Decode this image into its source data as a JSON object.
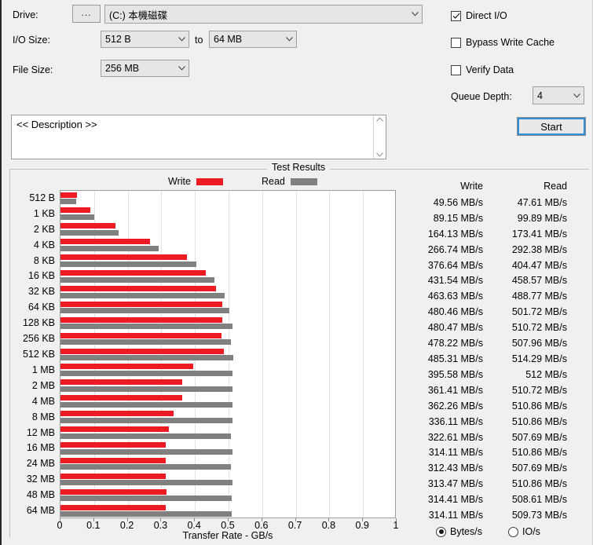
{
  "form": {
    "drive_label": "Drive:",
    "browse_button": "...",
    "drive_value": "(C:) 本機磁碟",
    "io_size_label": "I/O Size:",
    "io_size_from": "512 B",
    "io_size_to_label": "to",
    "io_size_to": "64 MB",
    "file_size_label": "File Size:",
    "file_size_value": "256 MB"
  },
  "options": {
    "direct_io": {
      "label": "Direct I/O",
      "checked": true
    },
    "bypass_write_cache": {
      "label": "Bypass Write Cache",
      "checked": false
    },
    "verify_data": {
      "label": "Verify Data",
      "checked": false
    },
    "queue_depth_label": "Queue Depth:",
    "queue_depth_value": "4",
    "start_button": "Start"
  },
  "description": {
    "text": "<< Description >>",
    "scroll_up_icon": "chevron-up-icon",
    "scroll_down_icon": "chevron-down-icon"
  },
  "results": {
    "group_title": "Test Results",
    "legend": [
      {
        "name": "Write",
        "color": "#ed1c24"
      },
      {
        "name": "Read",
        "color": "#808080"
      }
    ],
    "col_write": "Write",
    "col_read": "Read",
    "units": {
      "bytes_per_sec": {
        "label": "Bytes/s",
        "selected": true
      },
      "io_per_sec": {
        "label": "IO/s",
        "selected": false
      }
    }
  },
  "chart_data": {
    "type": "bar",
    "orientation": "horizontal",
    "title": "Test Results",
    "xlabel": "Transfer Rate - GB/s",
    "ylabel": "",
    "xlim": [
      0,
      1
    ],
    "xticks": [
      "0",
      "0.1",
      "0.2",
      "0.3",
      "0.4",
      "0.5",
      "0.6",
      "0.7",
      "0.8",
      "0.9",
      "1"
    ],
    "grid": true,
    "legend_position": "top",
    "unit_note": "values listed in MB/s; bars plotted in GB/s",
    "categories": [
      "512 B",
      "1 KB",
      "2 KB",
      "4 KB",
      "8 KB",
      "16 KB",
      "32 KB",
      "64 KB",
      "128 KB",
      "256 KB",
      "512 KB",
      "1 MB",
      "2 MB",
      "4 MB",
      "8 MB",
      "12 MB",
      "16 MB",
      "24 MB",
      "32 MB",
      "48 MB",
      "64 MB"
    ],
    "series": [
      {
        "name": "Write",
        "color": "#ed1c24",
        "values": [
          49.56,
          89.15,
          164.13,
          266.74,
          376.64,
          431.54,
          463.63,
          480.46,
          480.47,
          478.22,
          485.31,
          395.58,
          361.41,
          362.26,
          336.11,
          322.61,
          314.11,
          312.43,
          313.47,
          314.41,
          314.11
        ],
        "labels": [
          "49.56 MB/s",
          "89.15 MB/s",
          "164.13 MB/s",
          "266.74 MB/s",
          "376.64 MB/s",
          "431.54 MB/s",
          "463.63 MB/s",
          "480.46 MB/s",
          "480.47 MB/s",
          "478.22 MB/s",
          "485.31 MB/s",
          "395.58 MB/s",
          "361.41 MB/s",
          "362.26 MB/s",
          "336.11 MB/s",
          "322.61 MB/s",
          "314.11 MB/s",
          "312.43 MB/s",
          "313.47 MB/s",
          "314.41 MB/s",
          "314.11 MB/s"
        ]
      },
      {
        "name": "Read",
        "color": "#808080",
        "values": [
          47.61,
          99.89,
          173.41,
          292.38,
          404.47,
          458.57,
          488.77,
          501.72,
          510.72,
          507.96,
          514.29,
          512,
          510.72,
          510.86,
          510.86,
          507.69,
          510.86,
          507.69,
          510.86,
          508.61,
          509.73
        ],
        "labels": [
          "47.61 MB/s",
          "99.89 MB/s",
          "173.41 MB/s",
          "292.38 MB/s",
          "404.47 MB/s",
          "458.57 MB/s",
          "488.77 MB/s",
          "501.72 MB/s",
          "510.72 MB/s",
          "507.96 MB/s",
          "514.29 MB/s",
          "512 MB/s",
          "510.72 MB/s",
          "510.86 MB/s",
          "510.86 MB/s",
          "507.69 MB/s",
          "510.86 MB/s",
          "507.69 MB/s",
          "510.86 MB/s",
          "508.61 MB/s",
          "509.73 MB/s"
        ]
      }
    ]
  }
}
